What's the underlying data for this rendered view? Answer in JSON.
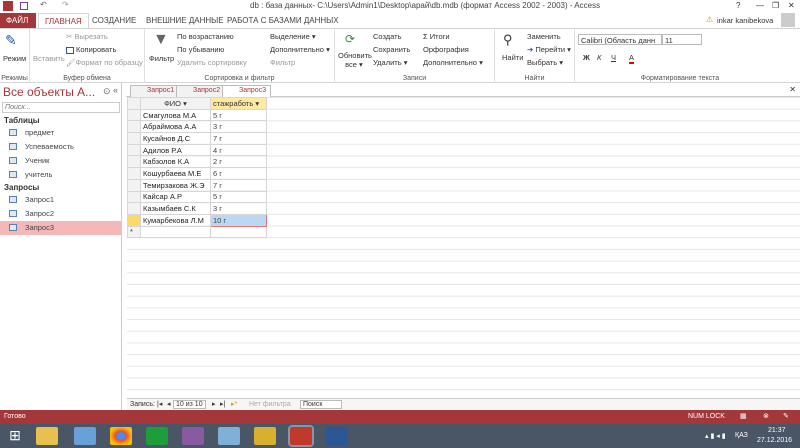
{
  "window": {
    "title": "db : база данных- C:\\Users\\Admin1\\Desktop\\арай\\db.mdb (формат Access 2002 - 2003) - Access",
    "help": "?",
    "minimize": "—",
    "restore": "❐",
    "close": "✕",
    "user": "inkar kanibekova"
  },
  "tabs": [
    "ФАЙЛ",
    "ГЛАВНАЯ",
    "СОЗДАНИЕ",
    "ВНЕШНИЕ ДАННЫЕ",
    "РАБОТА С БАЗАМИ ДАННЫХ"
  ],
  "ribbon": {
    "modes": {
      "label": "Режимы",
      "view": "Режим"
    },
    "clipboard": {
      "label": "Буфер обмена",
      "paste": "Вставить",
      "cut": "Вырезать",
      "copy": "Копировать",
      "format": "Формат по образцу"
    },
    "sort": {
      "label": "Сортировка и фильтр",
      "filter": "Фильтр",
      "asc": "По возрастанию",
      "desc": "По убыванию",
      "remove": "Удалить сортировку",
      "selection": "Выделение ▾",
      "advanced": "Дополнительно ▾",
      "toggle": "Фильтр"
    },
    "records": {
      "label": "Записи",
      "refresh": "Обновить все ▾",
      "new": "Создать",
      "save": "Сохранить",
      "delete": "Удалить ▾",
      "totals": "Итоги",
      "spelling": "Орфография",
      "more": "Дополнительно ▾"
    },
    "find": {
      "label": "Найти",
      "find": "Найти",
      "replace": "Заменить",
      "goto": "Перейти ▾",
      "select": "Выбрать ▾"
    },
    "text": {
      "label": "Форматирование текста",
      "font": "Calibri (Область данн",
      "size": "11",
      "bold": "Ж",
      "italic": "К",
      "underline": "Ч",
      "fontcolor": "A"
    }
  },
  "nav": {
    "title": "Все объекты A...",
    "search_placeholder": "Поиск...",
    "groups": [
      {
        "name": "Таблицы",
        "items": [
          "предмет",
          "Успеваемость",
          "Ученик",
          "учитель"
        ]
      },
      {
        "name": "Запросы",
        "items": [
          "Запрос1",
          "Запрос2",
          "Запрос3"
        ]
      }
    ]
  },
  "doc_tabs": [
    "Запрос1",
    "Запрос2",
    "Запрос3"
  ],
  "datasheet": {
    "columns": [
      "ФИО",
      "стажработь"
    ],
    "rows": [
      [
        "Смагулова М.А",
        "5 г"
      ],
      [
        "Абраймова А.А",
        "3 г"
      ],
      [
        "Кусайнов Д.С",
        "7 г"
      ],
      [
        "Адилов Р.А",
        "4 г"
      ],
      [
        "Кабзолов К.А",
        "2 г"
      ],
      [
        "Кошурбаева М.Е",
        "6 г"
      ],
      [
        "Темирзакова Ж.Э",
        "7 г"
      ],
      [
        "Кайсар А.Р",
        "5 г"
      ],
      [
        "Казымбаев С.К",
        "3 г"
      ],
      [
        "Кумарбекова Л.М",
        "10 г"
      ]
    ],
    "new_row": "*"
  },
  "recnav": {
    "label": "Запись:",
    "position": "10 из 10",
    "nofilter": "Нет фильтра",
    "search": "Поиск"
  },
  "status": {
    "text": "Готово",
    "numlock": "NUM LOCK"
  },
  "taskbar": {
    "lang": "ҚАЗ",
    "time": "21:37",
    "date": "27.12.2016"
  }
}
